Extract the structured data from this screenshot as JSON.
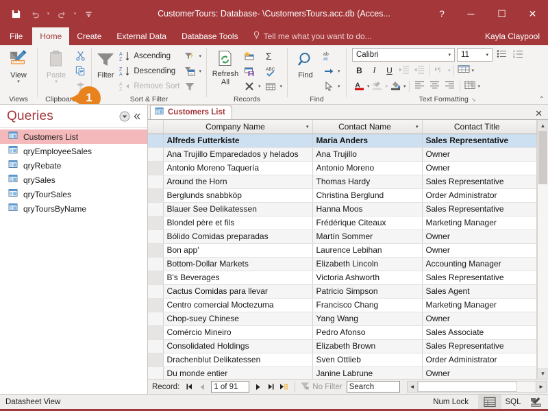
{
  "titlebar": {
    "title": "CustomerTours: Database- \\CustomersTours.acc.db (Acces...",
    "save_icon": "save-icon",
    "undo_icon": "undo-icon",
    "redo_icon": "redo-icon",
    "customize_icon": "customize-quick-access-icon",
    "help_label": "?",
    "minimize_label": "─",
    "maximize_label": "☐",
    "close_label": "✕"
  },
  "ribbon_tabs": {
    "file": "File",
    "tabs": [
      "Home",
      "Create",
      "External Data",
      "Database Tools"
    ],
    "active": "Home",
    "tellme": "Tell me what you want to do...",
    "user": "Kayla Claypool"
  },
  "ribbon": {
    "callout_number": "1",
    "groups": [
      {
        "name": "Views",
        "label": "Views",
        "big": [
          {
            "label": "View",
            "icon": "view-icon",
            "caret": "▾"
          }
        ]
      },
      {
        "name": "Clipboard",
        "label": "Clipboard",
        "launcher": "↘",
        "big": [
          {
            "label": "Paste",
            "icon": "paste-icon",
            "caret": "▾",
            "disabled": true
          }
        ],
        "small": [
          {
            "label": "",
            "icon": "cut-icon"
          },
          {
            "label": "",
            "icon": "copy-icon"
          },
          {
            "label": "",
            "icon": "format-painter-icon",
            "disabled": true
          }
        ]
      },
      {
        "name": "Sort & Filter",
        "label": "Sort & Filter",
        "big": [
          {
            "label": "Filter",
            "icon": "filter-icon"
          }
        ],
        "small": [
          {
            "label": "Ascending",
            "icon": "sort-ascending-icon"
          },
          {
            "label": "Descending",
            "icon": "sort-descending-icon"
          },
          {
            "label": "Remove Sort",
            "icon": "remove-sort-icon",
            "disabled": true
          }
        ],
        "small2": [
          {
            "label": "",
            "icon": "advanced-filter-icon",
            "caret": "▾"
          },
          {
            "label": "",
            "icon": "filter-by-form-icon",
            "caret": "▾"
          },
          {
            "label": "",
            "icon": "toggle-filter-icon"
          }
        ]
      },
      {
        "name": "Records",
        "label": "Records",
        "big": [
          {
            "label": "Refresh\nAll",
            "icon": "refresh-all-icon",
            "caret": "▾"
          }
        ],
        "small": [
          {
            "label": "",
            "icon": "new-record-icon"
          },
          {
            "label": "",
            "icon": "save-record-icon"
          },
          {
            "label": "",
            "icon": "delete-record-icon",
            "caret": "▾"
          }
        ],
        "small2": [
          {
            "label": "",
            "icon": "totals-icon"
          },
          {
            "label": "",
            "icon": "spelling-icon"
          },
          {
            "label": "",
            "icon": "more-records-icon",
            "caret": "▾"
          }
        ]
      },
      {
        "name": "Find",
        "label": "Find",
        "big": [
          {
            "label": "Find",
            "icon": "find-icon"
          }
        ],
        "small": [
          {
            "label": "",
            "icon": "replace-icon"
          },
          {
            "label": "",
            "icon": "go-to-icon",
            "caret": "▾"
          },
          {
            "label": "",
            "icon": "select-icon",
            "caret": "▾"
          }
        ]
      },
      {
        "name": "Text Formatting",
        "label": "Text Formatting",
        "launcher": "↘"
      }
    ],
    "text_formatting": {
      "font_name": "Calibri",
      "font_size": "11",
      "bold": "B",
      "italic": "I",
      "underline": "U",
      "bullets_icon": "bullets-icon",
      "numbering_icon": "numbering-icon",
      "decrease_indent_icon": "decrease-indent-icon",
      "increase_indent_icon": "increase-indent-icon",
      "rtl_icon": "text-direction-icon",
      "gridlines_icon": "gridlines-icon",
      "font_color_icon": "font-color-icon",
      "highlight_icon": "text-highlight-icon",
      "fill_color_icon": "background-color-icon",
      "align_left_icon": "align-left-icon",
      "align_center_icon": "align-center-icon",
      "align_right_icon": "align-right-icon",
      "alternate_row_icon": "alternate-row-color-icon",
      "collapse_icon": "collapse-ribbon-icon"
    }
  },
  "navpane": {
    "title": "Queries",
    "menu_icon": "dropdown-menu-icon",
    "collapse_icon": "shutter-bar-close-icon",
    "items": [
      {
        "label": "Customers List",
        "icon": "query-icon",
        "selected": true
      },
      {
        "label": "qryEmployeeSales",
        "icon": "query-icon"
      },
      {
        "label": "qryRebate",
        "icon": "query-icon"
      },
      {
        "label": "qrySales",
        "icon": "query-icon"
      },
      {
        "label": "qryTourSales",
        "icon": "query-icon"
      },
      {
        "label": "qryToursByName",
        "icon": "query-icon"
      }
    ]
  },
  "doctab": {
    "label": "Customers List",
    "icon": "query-icon",
    "close": "✕"
  },
  "datasheet": {
    "columns": [
      "Company Name",
      "Contact Name",
      "Contact Title"
    ],
    "rows": [
      [
        "Alfreds Futterkiste",
        "Maria Anders",
        "Sales Representative"
      ],
      [
        "Ana Trujillo Emparedados y helados",
        "Ana Trujillo",
        "Owner"
      ],
      [
        "Antonio Moreno Taquería",
        "Antonio Moreno",
        "Owner"
      ],
      [
        "Around the Horn",
        "Thomas Hardy",
        "Sales Representative"
      ],
      [
        "Berglunds snabbköp",
        "Christina Berglund",
        "Order Administrator"
      ],
      [
        "Blauer See Delikatessen",
        "Hanna Moos",
        "Sales Representative"
      ],
      [
        "Blondel père et fils",
        "Frédérique Citeaux",
        "Marketing Manager"
      ],
      [
        "Bólido Comidas preparadas",
        "Martín Sommer",
        "Owner"
      ],
      [
        "Bon app'",
        "Laurence Lebihan",
        "Owner"
      ],
      [
        "Bottom-Dollar Markets",
        "Elizabeth Lincoln",
        "Accounting Manager"
      ],
      [
        "B's Beverages",
        "Victoria Ashworth",
        "Sales Representative"
      ],
      [
        "Cactus Comidas para llevar",
        "Patricio Simpson",
        "Sales Agent"
      ],
      [
        "Centro comercial Moctezuma",
        "Francisco Chang",
        "Marketing Manager"
      ],
      [
        "Chop-suey Chinese",
        "Yang Wang",
        "Owner"
      ],
      [
        "Comércio Mineiro",
        "Pedro Afonso",
        "Sales Associate"
      ],
      [
        "Consolidated Holdings",
        "Elizabeth Brown",
        "Sales Representative"
      ],
      [
        "Drachenblut Delikatessen",
        "Sven Ottlieb",
        "Order Administrator"
      ],
      [
        "Du monde entier",
        "Janine Labrune",
        "Owner"
      ]
    ],
    "selected_row": 0
  },
  "recordnav": {
    "label": "Record:",
    "first": "⏮",
    "prev": "◄",
    "value": "1 of 91",
    "next": "►",
    "last": "⏭",
    "new": "►",
    "filter_label": "No Filter",
    "filter_icon": "no-filter-icon",
    "search_value": "Search"
  },
  "statusbar": {
    "view_label": "Datasheet View",
    "num_lock": "Num Lock",
    "datasheet_view_icon": "datasheet-view-icon",
    "sql_view_label": "SQL",
    "design_view_icon": "design-view-icon"
  }
}
